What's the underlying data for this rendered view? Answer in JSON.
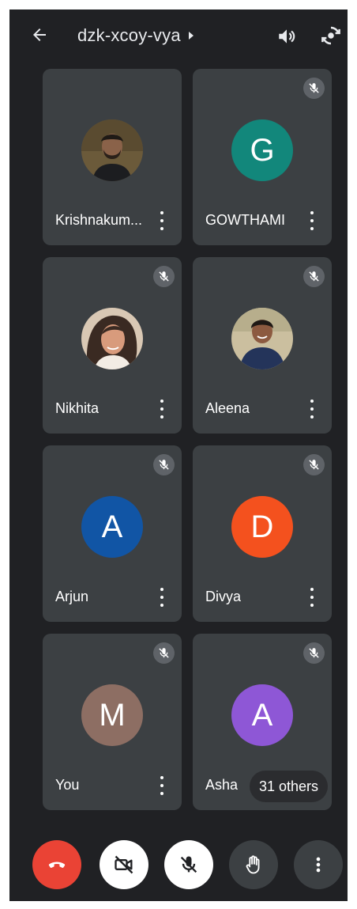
{
  "meeting": {
    "code": "dzk-xcoy-vya"
  },
  "colors": {
    "background": "#202124",
    "tile": "#3c4043",
    "end_call": "#ea4335",
    "avatar_G": "#12877b",
    "avatar_A_blue": "#1155a5",
    "avatar_D": "#f4511e",
    "avatar_M": "#8d6e63",
    "avatar_A_purple": "#8e57d6"
  },
  "participants": [
    {
      "name": "Krishnakum...",
      "avatar": "photo",
      "muted": false
    },
    {
      "name": "GOWTHAMI",
      "avatar_letter": "G",
      "muted": true
    },
    {
      "name": "Nikhita",
      "avatar": "photo",
      "muted": true
    },
    {
      "name": "Aleena",
      "avatar": "photo",
      "muted": true
    },
    {
      "name": "Arjun",
      "avatar_letter": "A",
      "muted": true
    },
    {
      "name": "Divya",
      "avatar_letter": "D",
      "muted": true
    },
    {
      "name": "You",
      "avatar_letter": "M",
      "muted": true
    },
    {
      "name": "Asha",
      "avatar_letter": "A",
      "muted": true,
      "others_label": "31 others"
    }
  ],
  "icons": {
    "back": "arrow-left-icon",
    "title_caret": "caret-right-icon",
    "speaker": "speaker-icon",
    "camera_flip": "camera-flip-icon",
    "end_call": "phone-hangup-icon",
    "camera_off": "video-off-icon",
    "mic_off": "mic-off-icon",
    "raise_hand": "hand-icon",
    "more": "more-vertical-icon"
  }
}
